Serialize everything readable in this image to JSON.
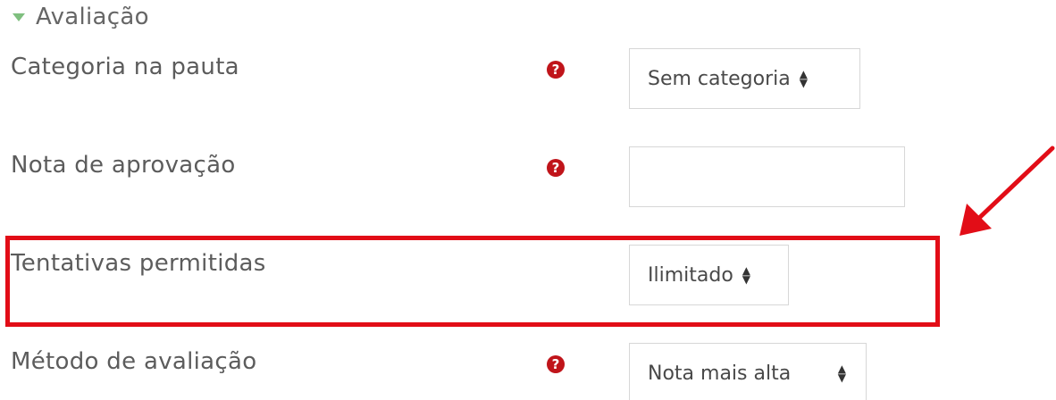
{
  "section": {
    "title": "Avaliação"
  },
  "fields": {
    "categoria": {
      "label": "Categoria na pauta",
      "value": "Sem categoria"
    },
    "nota_aprovacao": {
      "label": "Nota de aprovação",
      "value": ""
    },
    "tentativas": {
      "label": "Tentativas permitidas",
      "value": "Ilimitado"
    },
    "metodo": {
      "label": "Método de avaliação",
      "value": "Nota mais alta"
    }
  },
  "help_icon_glyph": "?",
  "colors": {
    "highlight": "#e20d17",
    "help_icon": "#c0141a",
    "section_triangle": "#7fbf7f"
  },
  "icons": {
    "help": "question-circle-icon",
    "section_toggle": "triangle-down-icon",
    "select_caret": "sort-caret-icon",
    "annotation": "red-arrow-icon"
  }
}
